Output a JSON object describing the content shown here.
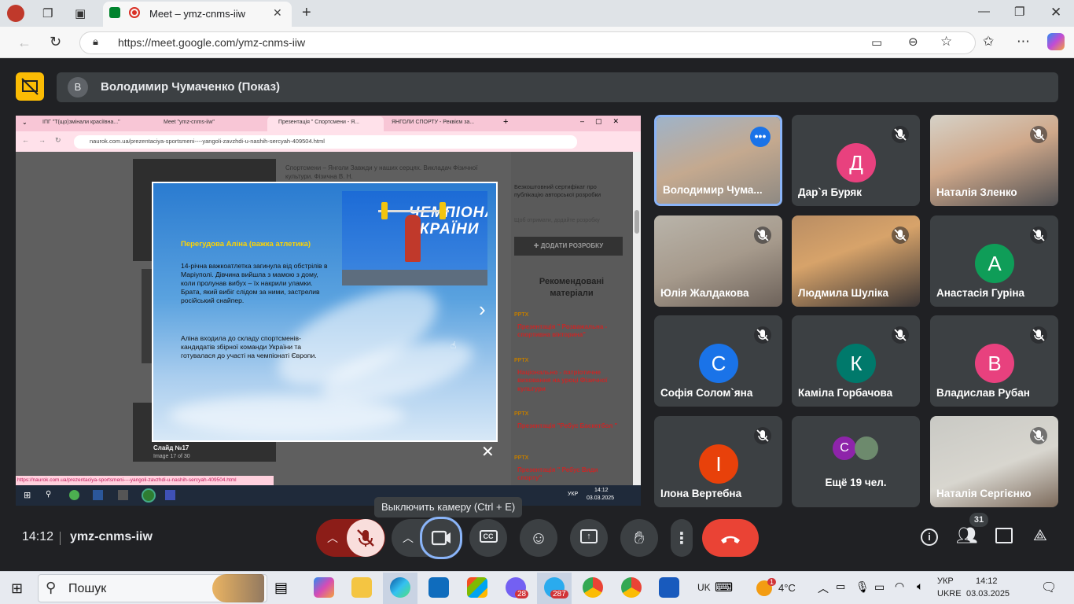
{
  "browser": {
    "tab_title": "Meet – ymz-cnms-iiw",
    "url": "https://meet.google.com/ymz-cnms-iiw"
  },
  "presenter": {
    "avatar_letter": "В",
    "name": "Володимир Чумаченко (Показ)"
  },
  "shared_screen": {
    "tabs": [
      "ІПГ \"Т(що)змінали красіївна...\"",
      "Meet \"ymz-cnms-iiw\"",
      "Презентація \" Спортсмени - Я...",
      "ЯНГОЛИ СПОРТУ - Реквієм за..."
    ],
    "url": "naurok.com.ua/prezentaciya-sportsmeni----yangoli-zavzhdi-u-nashih-sercyah-409504.html",
    "status_url": "https://naurok.com.ua/prezentaciya-sportsmeni----yangoli-zavzhdi-u-nashih-sercyah-409504.html",
    "page_header_text": "Спортсмени – Янголи Завжди у наших серцях. Викладач Фізичної культури. Фізична В. Н.",
    "right_panel": {
      "cert_text": "Безкоштовний сертифікат про публікацію авторської розробки",
      "cert_link": "Щоб отримати, додайте розробку",
      "add_button": "✚ ДОДАТИ РОЗРОБКУ",
      "recommended_title": "Рекомендовані матеріали",
      "items": [
        "Презентація \" Розважальна - спортивна вікторина\"",
        "Національно - патріотичне виховання на уроці Фізичної культури",
        "Презентація \"Ребус Баскетбол \"",
        "Презентація \" Ребус Види спорту\""
      ],
      "badge": "PPTX"
    },
    "slide": {
      "photo_banner": "ЧЕМПІОНАТ УКРАЇНИ",
      "heading": "Перегудова Аліна (важка атлетика)",
      "paragraph1": "14-річна важкоатлетка загинула від обстрілів в Маріуполі. Дівчина вийшла з мамою з дому, коли пролунав вибух – їх накрили уламки. Брата, який вибіг слідом за ними, застрелив російський снайпер.",
      "paragraph2": "Аліна входила до складу спортсменів-кандидатів збірної команди України та готувалася до участі на чемпіонаті Європи.",
      "caption": "Слайд №17",
      "counter": "Image 17 of 30"
    },
    "taskbar": {
      "lang": "УКР",
      "time": "14:12",
      "date": "03.03.2025"
    }
  },
  "participants": [
    {
      "name": "Володимир Чума...",
      "type": "video",
      "active": true
    },
    {
      "name": "Дар`я Буряк",
      "type": "avatar",
      "letter": "Д",
      "color": "#e8417e"
    },
    {
      "name": "Наталія Зленко",
      "type": "video"
    },
    {
      "name": "Юлія Жалдакова",
      "type": "video"
    },
    {
      "name": "Людмила Шуліка",
      "type": "video"
    },
    {
      "name": "Анастасія Гуріна",
      "type": "avatar",
      "letter": "А",
      "color": "#0f9d58"
    },
    {
      "name": "Софія Солом`яна",
      "type": "avatar",
      "letter": "С",
      "color": "#1a73e8"
    },
    {
      "name": "Каміла Горбачова",
      "type": "avatar",
      "letter": "К",
      "color": "#00796b"
    },
    {
      "name": "Владислав Рубан",
      "type": "avatar",
      "letter": "В",
      "color": "#e8417e"
    },
    {
      "name": "Ілона Вертебна",
      "type": "avatar",
      "letter": "І",
      "color": "#e8410a"
    },
    {
      "name": "Ещё 19 чел.",
      "type": "more",
      "letter": "С"
    },
    {
      "name": "Наталія Сергієнко",
      "type": "video"
    }
  ],
  "bottom_bar": {
    "time": "14:12",
    "meeting_code": "ymz-cnms-iiw",
    "tooltip": "Выключить камеру (Ctrl + E)",
    "participants_count": "31"
  },
  "windows_taskbar": {
    "search_placeholder": "Пошук",
    "weather": "4°C",
    "lang_top": "УКР",
    "lang_bottom": "UKRE",
    "ime": "UK",
    "time": "14:12",
    "date": "03.03.2025",
    "badge_viber": "28",
    "badge_telegram": "287",
    "badge_weather": "1"
  },
  "colors": {
    "meet_bg": "#202124",
    "end_call": "#ea4335",
    "mic_muted": "#f9dedc",
    "present_icon": "#fbbc04"
  }
}
